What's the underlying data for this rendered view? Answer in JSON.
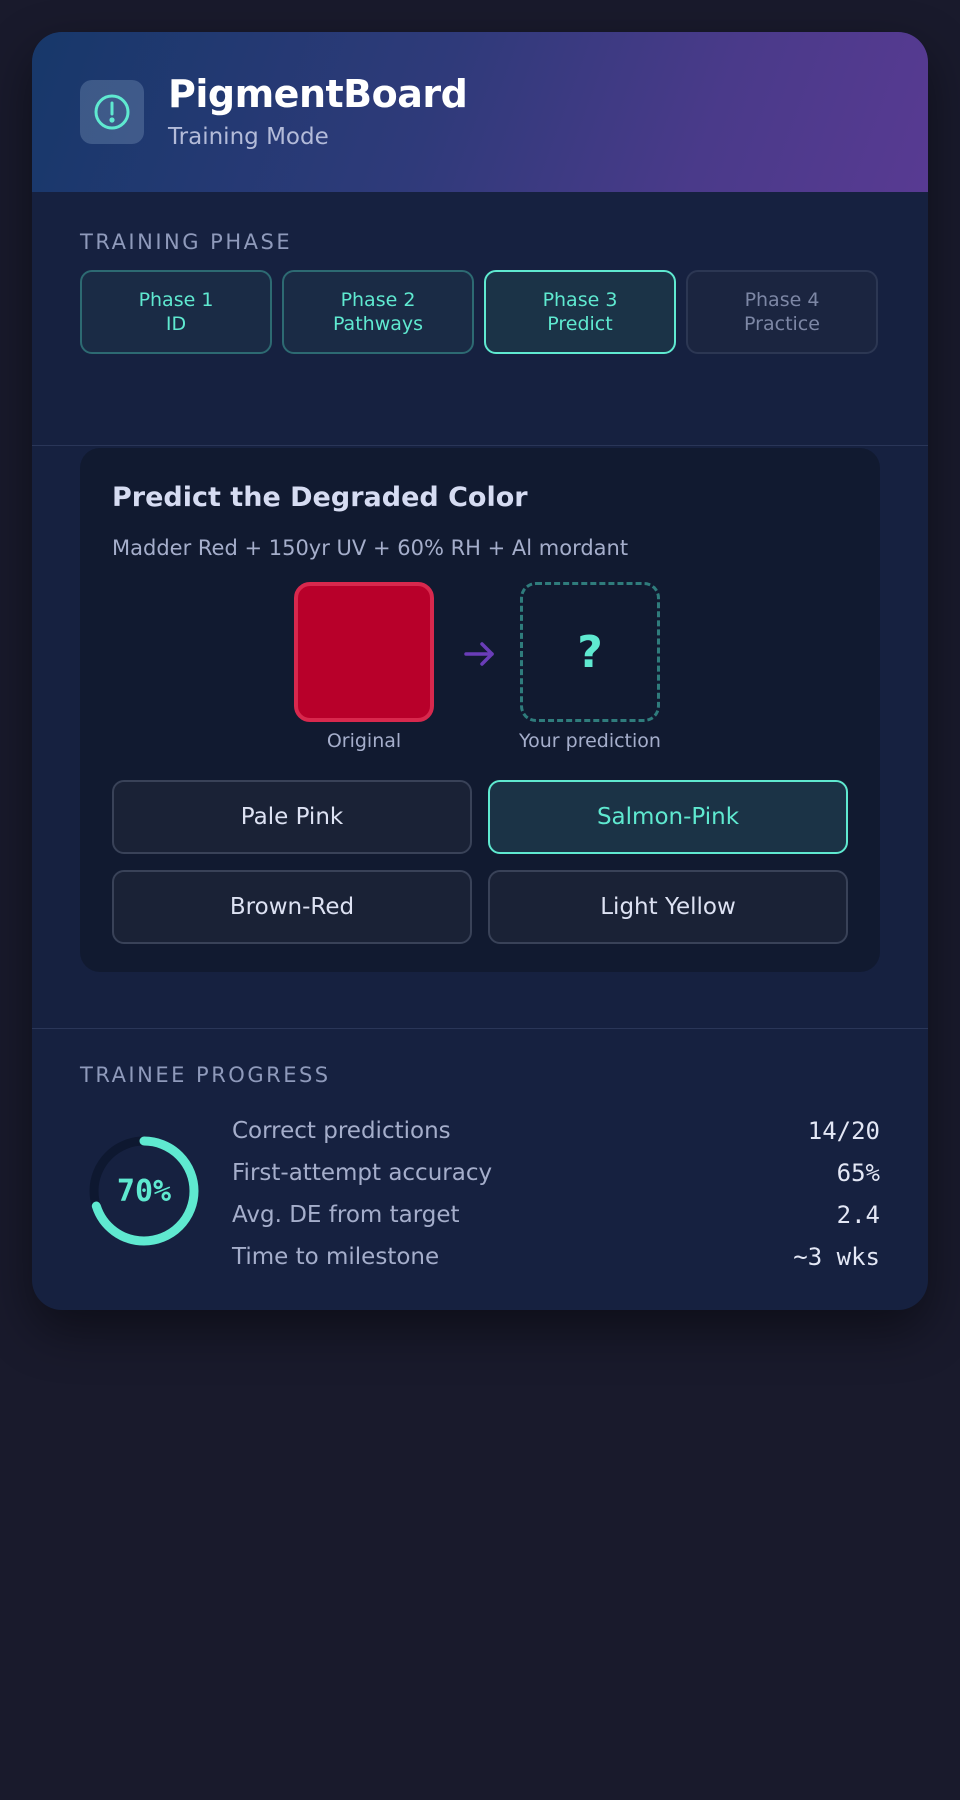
{
  "header": {
    "title": "PigmentBoard",
    "subtitle": "Training Mode",
    "logo_icon": "alert-circle-icon"
  },
  "phase_section": {
    "label": "TRAINING PHASE",
    "phases": [
      {
        "line1": "Phase 1",
        "line2": "ID",
        "state": "completed"
      },
      {
        "line1": "Phase 2",
        "line2": "Pathways",
        "state": "completed"
      },
      {
        "line1": "Phase 3",
        "line2": "Predict",
        "state": "active"
      },
      {
        "line1": "Phase 4",
        "line2": "Practice",
        "state": "locked"
      }
    ]
  },
  "predict": {
    "title": "Predict the Degraded Color",
    "description": "Madder Red + 150yr UV + 60% RH + Al mordant",
    "original_color": "#b8002a",
    "original_caption": "Original",
    "prediction_placeholder": "?",
    "prediction_caption": "Your prediction",
    "options": [
      {
        "label": "Pale Pink",
        "selected": false
      },
      {
        "label": "Salmon-Pink",
        "selected": true
      },
      {
        "label": "Brown-Red",
        "selected": false
      },
      {
        "label": "Light Yellow",
        "selected": false
      }
    ]
  },
  "progress": {
    "label": "TRAINEE PROGRESS",
    "percent": 70,
    "percent_label": "70%",
    "stats": [
      {
        "label": "Correct predictions",
        "value": "14/20"
      },
      {
        "label": "First-attempt accuracy",
        "value": "65%"
      },
      {
        "label": "Avg. DE from target",
        "value": "2.4"
      },
      {
        "label": "Time to milestone",
        "value": "~3 wks"
      }
    ]
  },
  "colors": {
    "accent": "#5fe9d0",
    "arrow": "#6a3db8",
    "page_background": "#191a2c",
    "card_background": "#162140"
  }
}
